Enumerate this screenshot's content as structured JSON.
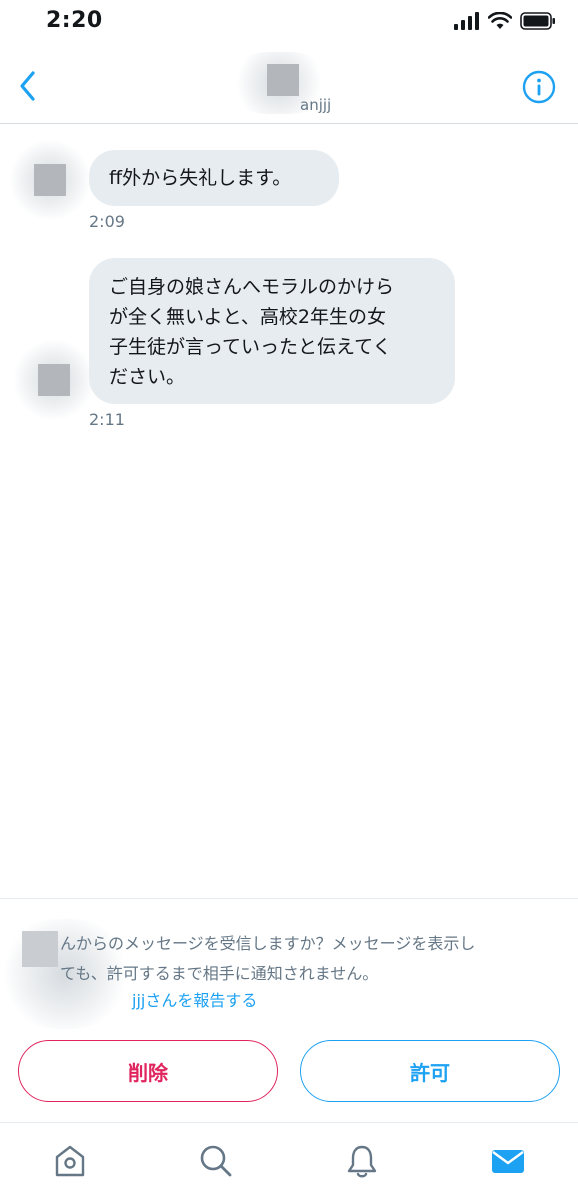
{
  "status_bar": {
    "time": "2:20"
  },
  "header": {
    "handle_suffix": "anjjj"
  },
  "messages": [
    {
      "text": "ff外から失礼します。",
      "time": "2:09"
    },
    {
      "lines": [
        "ご自身の娘さんへモラルのかけら",
        "が全く無いよと、高校2年生の女",
        "子生徒が言っていったと伝えてく",
        "ださい。"
      ],
      "time": "2:11"
    }
  ],
  "request": {
    "line1": "んからのメッセージを受信しますか？メッセージを表示し",
    "line2": "ても、許可するまで相手に通知されません。",
    "report_link": "jjjさんを報告する",
    "delete_label": "削除",
    "allow_label": "許可"
  },
  "colors": {
    "accent": "#1da1f2",
    "danger": "#e0245e",
    "bubble": "#e6ecf0",
    "secondary_text": "#657786"
  },
  "icons": {
    "back": "chevron-left-icon",
    "info": "info-icon",
    "tabs": [
      "home-icon",
      "search-icon",
      "bell-icon",
      "mail-icon"
    ]
  }
}
